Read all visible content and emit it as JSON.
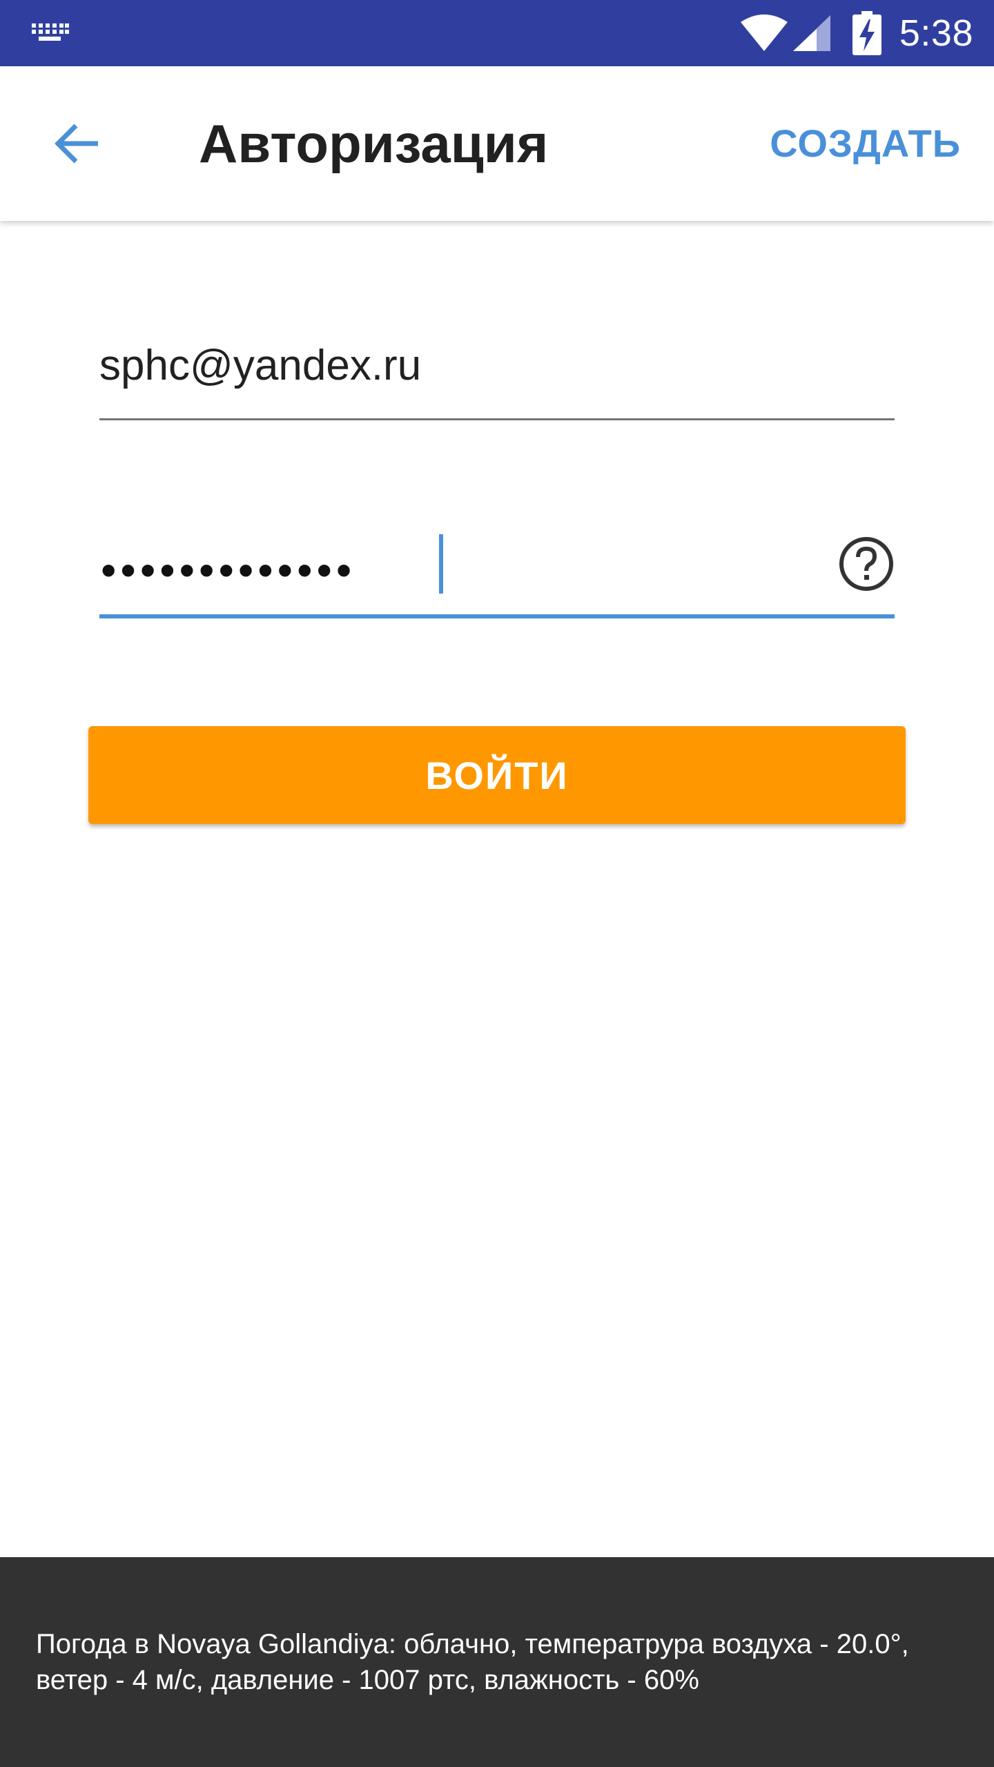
{
  "status_bar": {
    "time": "5:38",
    "icons": [
      "keyboard-icon",
      "wifi-icon",
      "cell-signal-icon",
      "battery-charging-icon"
    ]
  },
  "app_bar": {
    "back_icon": "arrow-back-icon",
    "title": "Авторизация",
    "action_label": "СОЗДАТЬ"
  },
  "form": {
    "email_value": "sphc@yandex.ru",
    "password_value": "•••••••••••••",
    "help_icon": "question-circle-icon",
    "login_label": "ВОЙТИ"
  },
  "footer": {
    "weather_text": "Погода в Novaya Gollandiya: облачно, температрура воздуха - 20.0°, ветер - 4 м/с, давление - 1007 ртс, влажность - 60%"
  },
  "colors": {
    "status_bar": "#303f9f",
    "accent_blue": "#4a90d9",
    "login_button": "#ff9800",
    "footer_bg": "#323232"
  }
}
